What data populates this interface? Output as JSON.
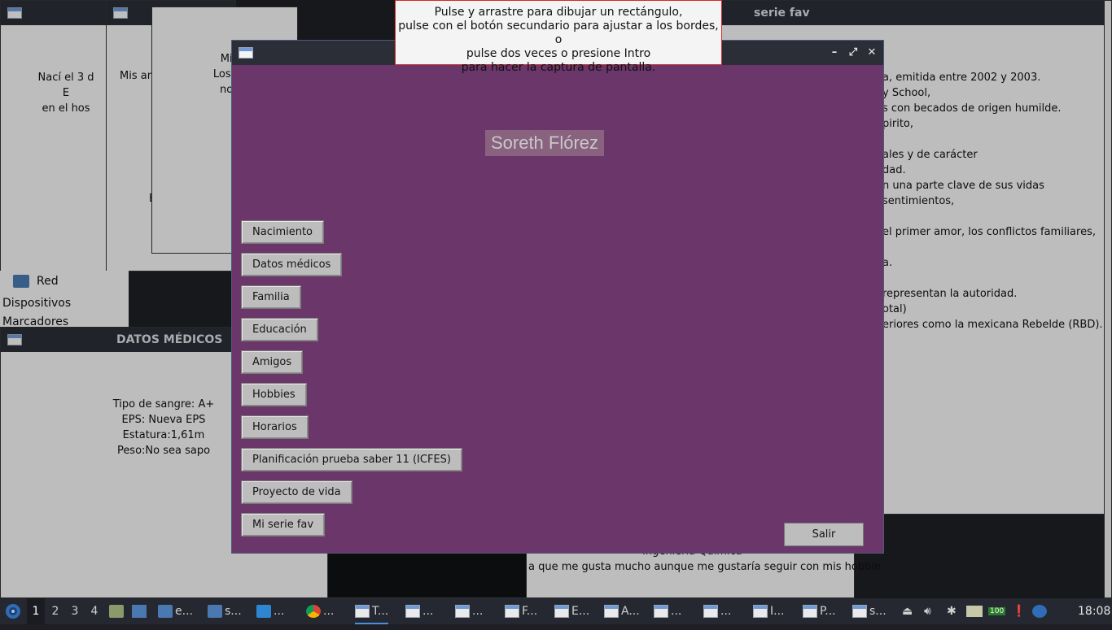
{
  "background_windows": {
    "birth_text": [
      "Nací el 3 d",
      "E",
      "en el hos"
    ],
    "family_text": [
      "Mis am"
    ],
    "window3_text": [
      "Mi ru",
      "Los mié",
      "norm"
    ],
    "serie_title": "serie fav",
    "serie_lines": [
      "a, emitida entre 2002 y 2003.",
      "y School,",
      "s con becados de origen humilde.",
      "pirito,",
      "",
      "ales y de carácter",
      "dad.",
      "n una parte clave de sus vidas",
      "sentimientos,",
      "",
      "el primer amor, los conflictos familiares,",
      "",
      "a.",
      "",
      "representan la autoridad.",
      "otal)",
      "eriores como la mexicana Rebelde (RBD)."
    ],
    "file_manager": {
      "network": "Red",
      "devices": "Dispositivos",
      "bookmarks": "Marcadores"
    },
    "medical_title": "DATOS MÉDICOS",
    "medical_lines": [
      "Tipo de sangre: A+",
      "EPS: Nueva EPS",
      "Estatura:1,61m",
      "Peso:No sea sapo"
    ],
    "bottom_lines": [
      "Ingeniería Química",
      "a que me gusta mucho aunque me gustaría seguir con mis hobbie"
    ]
  },
  "capture_tooltip": [
    "Pulse y arrastre para dibujar un rectángulo,",
    "pulse con el botón secundario para ajustar a los bordes, o",
    "pulse dos veces o presione Intro",
    "para hacer la captura de pantalla."
  ],
  "main_window": {
    "title": "",
    "name": "Soreth Flórez",
    "buttons": [
      "Nacimiento",
      "Datos médicos",
      "Familia",
      "Educación",
      "Amigos",
      "Hobbies",
      "Horarios",
      "Planificación prueba saber 11 (ICFES)",
      "Proyecto de vida",
      "Mi serie fav"
    ],
    "exit": "Salir",
    "controls": {
      "minimize": "–",
      "maximize": "⤢",
      "close": "✕"
    },
    "bg_color": "#6b3669"
  },
  "taskbar": {
    "workspaces": [
      "1",
      "2",
      "3",
      "4"
    ],
    "tasks": [
      "e...",
      "s...",
      "...",
      "...",
      "T...",
      "...",
      "...",
      "F...",
      "E...",
      "A...",
      "...",
      "...",
      "I...",
      "P...",
      "s..."
    ],
    "clock": "18:08",
    "battery": "100"
  }
}
